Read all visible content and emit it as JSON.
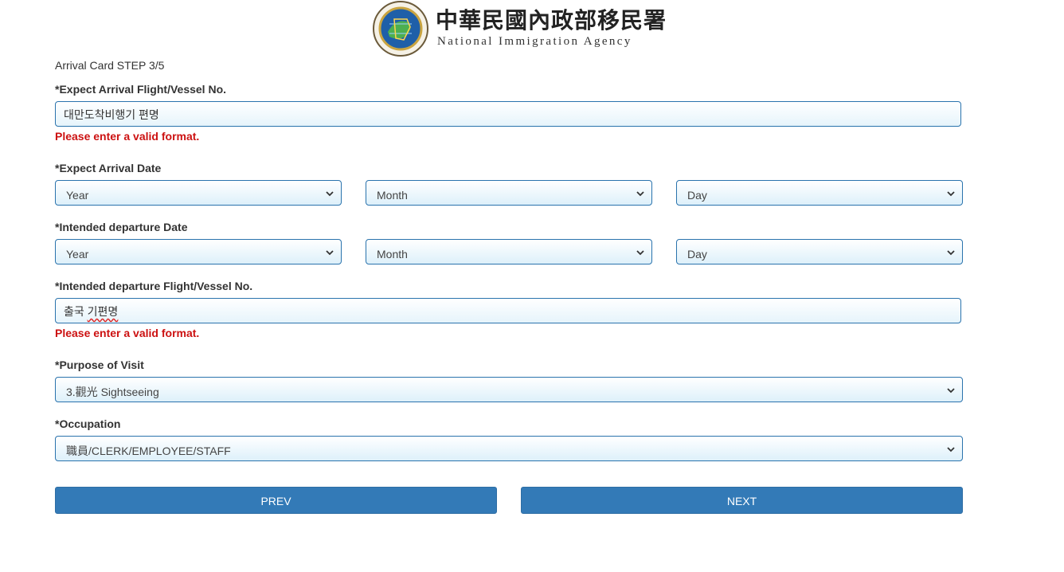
{
  "header": {
    "agency_cn": "中華民國內政部移民署",
    "agency_en": "National Immigration Agency",
    "logo_icon": "national-immigration-agency-seal"
  },
  "form": {
    "step_label": "Arrival Card STEP 3/5",
    "arrival_flight": {
      "label": "*Expect Arrival Flight/Vessel No.",
      "value": "대만도착비행기 편명",
      "error": "Please enter a valid format."
    },
    "arrival_date": {
      "label": "*Expect Arrival Date",
      "year": "Year",
      "month": "Month",
      "day": "Day"
    },
    "departure_date": {
      "label": "*Intended departure Date",
      "year": "Year",
      "month": "Month",
      "day": "Day"
    },
    "departure_flight": {
      "label": "*Intended departure Flight/Vessel No.",
      "value_prefix": "출국 ",
      "value_squiggle": "기편명",
      "error": "Please enter a valid format."
    },
    "purpose": {
      "label": "*Purpose of Visit",
      "value": "3.觀光 Sightseeing"
    },
    "occupation": {
      "label": "*Occupation",
      "value": "職員/CLERK/EMPLOYEE/STAFF"
    },
    "buttons": {
      "prev": "PREV",
      "next": "NEXT"
    }
  },
  "colors": {
    "accent": "#337ab7",
    "error": "#cc1111",
    "border": "#2a73ad"
  }
}
